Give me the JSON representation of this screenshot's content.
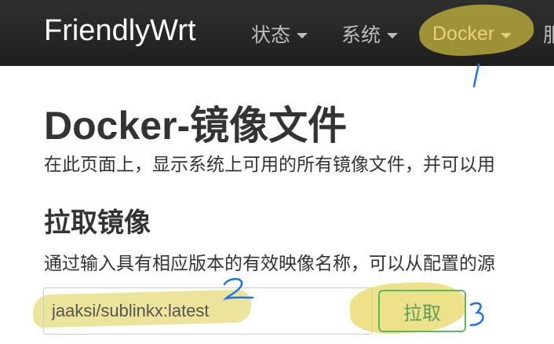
{
  "navbar": {
    "brand": "FriendlyWrt",
    "items": [
      {
        "label": "状态"
      },
      {
        "label": "系统"
      },
      {
        "label": "Docker"
      },
      {
        "label": "服"
      }
    ]
  },
  "main": {
    "title": "Docker-镜像文件",
    "description": "在此页面上，显示系统上可用的所有镜像文件，并可以用",
    "pull_section": {
      "title": "拉取镜像",
      "description": "通过输入具有相应版本的有效映像名称，可以从配置的源",
      "input_value": "jaaksi/sublinkx:latest",
      "button_label": "拉取"
    }
  },
  "annotations": {
    "marks": [
      "1",
      "2",
      "3"
    ],
    "highlight_color": "#d8c43c",
    "pen_color": "#1a73e8"
  }
}
